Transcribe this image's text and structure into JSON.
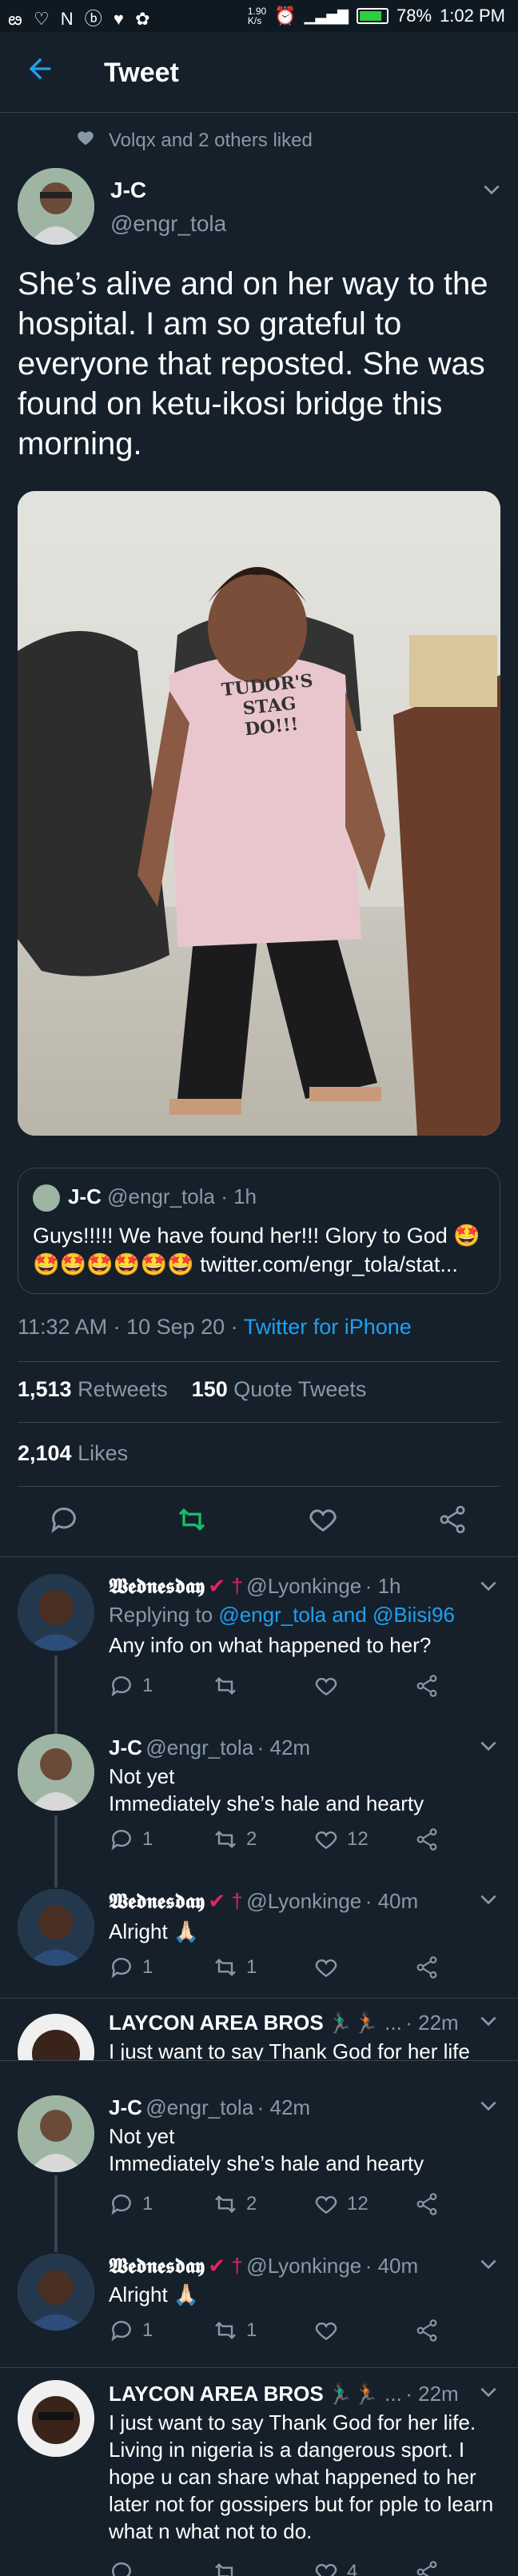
{
  "status_bar": {
    "left_icons": "ఴ ♡ N ⓑ ♥ ✿",
    "net_speed": "1.90\nK/s",
    "battery": "78%",
    "time": "1:02 PM"
  },
  "header": {
    "title": "Tweet"
  },
  "social_context": "Volqx and 2 others liked",
  "main_tweet": {
    "name": "J-C",
    "handle": "@engr_tola",
    "text": "She’s alive and on her way to the hospital. I am so grateful to everyone that reposted. She was found on ketu-ikosi bridge this morning.",
    "photo_shirt_text": "TUDOR'S\nSTAG\nDO!!!",
    "quote": {
      "name": "J-C",
      "handle": "@engr_tola",
      "time": "· 1h",
      "text": "Guys!!!!! We have found her!!! Glory to God 🤩🤩🤩🤩🤩🤩🤩 twitter.com/engr_tola/stat..."
    },
    "timestamp": "11:32 AM · 10 Sep 20 · ",
    "source": "Twitter for iPhone",
    "retweets_count": "1,513",
    "retweets_label": "Retweets",
    "quotes_count": "150",
    "quotes_label": "Quote Tweets",
    "likes_count": "2,104",
    "likes_label": "Likes"
  },
  "replies": [
    {
      "name": "𝖂𝖊𝖉𝖓𝖊𝖘𝖉𝖆𝖞",
      "badges": "✔ †",
      "handle": "@Lyonkinge",
      "time": "· 1h",
      "replying_prefix": "Replying to ",
      "replying_to": "@engr_tola and @Biisi96",
      "text": "Any info on what happened to her?",
      "reply_count": "1",
      "retweet_count": "",
      "like_count": ""
    },
    {
      "name": "J-C",
      "handle": "@engr_tola",
      "time": "· 42m",
      "text": "Not yet\nImmediately she’s hale and hearty",
      "reply_count": "1",
      "retweet_count": "2",
      "like_count": "12"
    },
    {
      "name": "𝖂𝖊𝖉𝖓𝖊𝖘𝖉𝖆𝖞",
      "badges": "✔ †",
      "handle": "@Lyonkinge",
      "time": "· 40m",
      "text": "Alright 🙏🏻",
      "reply_count": "1",
      "retweet_count": "1",
      "like_count": ""
    },
    {
      "name": "LAYCON AREA BROS",
      "badges": "🏃🏿‍♂️🏃🏿 ...",
      "time": "· 22m",
      "text": "I just want to say Thank God for her life"
    },
    {
      "name": "J-C",
      "handle": "@engr_tola",
      "time": "· 42m",
      "text": "Not yet\nImmediately she’s hale and hearty",
      "reply_count": "1",
      "retweet_count": "2",
      "like_count": "12"
    },
    {
      "name": "𝖂𝖊𝖉𝖓𝖊𝖘𝖉𝖆𝖞",
      "badges": "✔ †",
      "handle": "@Lyonkinge",
      "time": "· 40m",
      "text": "Alright 🙏🏻",
      "reply_count": "1",
      "retweet_count": "1",
      "like_count": ""
    },
    {
      "name": "LAYCON AREA BROS",
      "badges": "🏃🏿‍♂️🏃🏿 ...",
      "time": "· 22m",
      "text": "I just want to say Thank God for her life. Living in nigeria is a dangerous sport. I hope u can share what happened to her later not for gossipers but for pple to learn what n what not to do.",
      "reply_count": "",
      "retweet_count": "",
      "like_count": "4"
    }
  ],
  "colors": {
    "background": "#15202b",
    "accent": "#1da1f2",
    "muted": "#8899a6",
    "retweet_green": "#17bf63",
    "divider": "#38444d"
  }
}
